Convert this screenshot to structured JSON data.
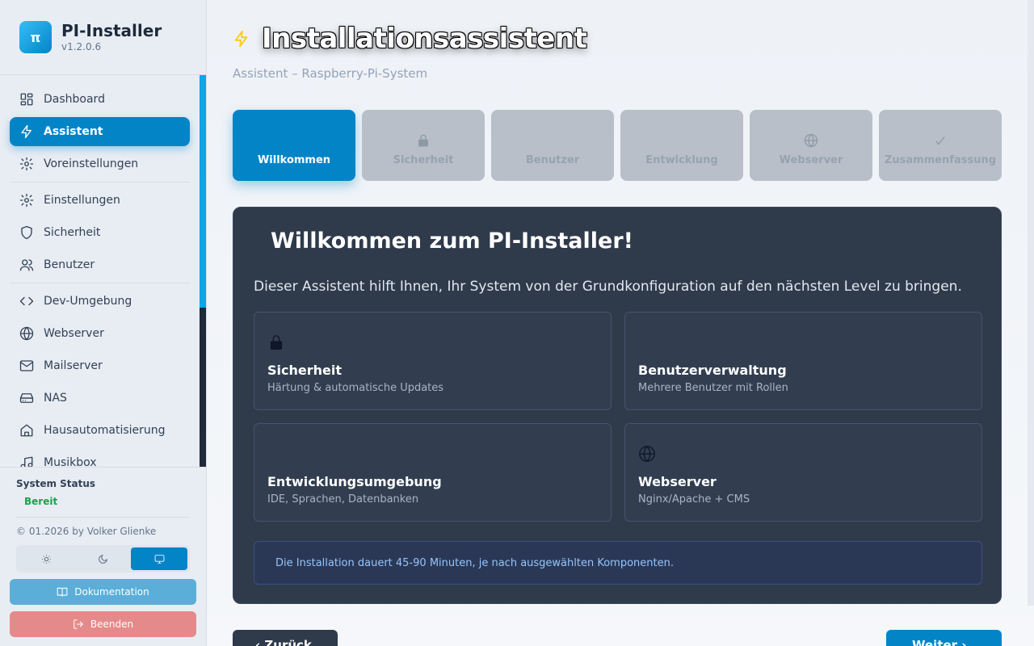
{
  "brand": {
    "logo": "π",
    "title": "PI-Installer",
    "version": "v1.2.0.6"
  },
  "sidebar": {
    "items": [
      {
        "label": "Dashboard",
        "icon": "dashboard-icon",
        "active": false
      },
      {
        "label": "Assistent",
        "icon": "lightning-icon",
        "active": true
      },
      {
        "label": "Voreinstellungen",
        "icon": "gear-icon",
        "active": false
      },
      {
        "label": "Einstellungen",
        "icon": "gear-icon",
        "active": false
      },
      {
        "label": "Sicherheit",
        "icon": "shield-icon",
        "active": false
      },
      {
        "label": "Benutzer",
        "icon": "users-icon",
        "active": false
      },
      {
        "label": "Dev-Umgebung",
        "icon": "code-icon",
        "active": false
      },
      {
        "label": "Webserver",
        "icon": "globe-icon",
        "active": false
      },
      {
        "label": "Mailserver",
        "icon": "mail-icon",
        "active": false
      },
      {
        "label": "NAS",
        "icon": "hard-drive-icon",
        "active": false
      },
      {
        "label": "Hausautomatisierung",
        "icon": "home-icon",
        "active": false
      },
      {
        "label": "Musikbox",
        "icon": "music-icon",
        "active": false
      }
    ],
    "status_title": "System Status",
    "status_value": "Bereit",
    "status_color": "#16a34a",
    "copyright": "© 01.2026 by Volker Glienke",
    "theme_options": [
      "sun-icon",
      "moon-icon",
      "monitor-icon"
    ],
    "theme_selected": "monitor-icon",
    "docs_label": "Dokumentation",
    "quit_label": "Beenden"
  },
  "header": {
    "title": "Installationsassistent",
    "subtitle": "Assistent – Raspberry-Pi-System"
  },
  "steps": [
    {
      "label": "Willkommen",
      "icon": "",
      "active": true
    },
    {
      "label": "Sicherheit",
      "icon": "lock-icon",
      "active": false
    },
    {
      "label": "Benutzer",
      "icon": "",
      "active": false
    },
    {
      "label": "Entwicklung",
      "icon": "",
      "active": false
    },
    {
      "label": "Webserver",
      "icon": "globe-icon",
      "active": false
    },
    {
      "label": "Zusammenfassung",
      "icon": "check-icon",
      "active": false
    }
  ],
  "welcome": {
    "title": "Willkommen zum PI-Installer!",
    "intro": "Dieser Assistent hilft Ihnen, Ihr System von der Grundkonfiguration auf den nächsten Level zu bringen.",
    "features": [
      {
        "name": "Sicherheit",
        "desc": "Härtung & automatische Updates",
        "icon": "lock-icon"
      },
      {
        "name": "Benutzerverwaltung",
        "desc": "Mehrere Benutzer mit Rollen",
        "icon": ""
      },
      {
        "name": "Entwicklungsumgebung",
        "desc": "IDE, Sprachen, Datenbanken",
        "icon": ""
      },
      {
        "name": "Webserver",
        "desc": "Nginx/Apache + CMS",
        "icon": "globe-icon"
      }
    ],
    "info": "Die Installation dauert 45-90 Minuten, je nach ausgewählten Komponenten."
  },
  "footer_nav": {
    "back_label": "‹ Zurück",
    "next_label": "Weiter ›"
  },
  "colors": {
    "accent": "#0284c7",
    "card_bg": "#2f3a4b",
    "sidebar_bg": "#e8edf4"
  }
}
